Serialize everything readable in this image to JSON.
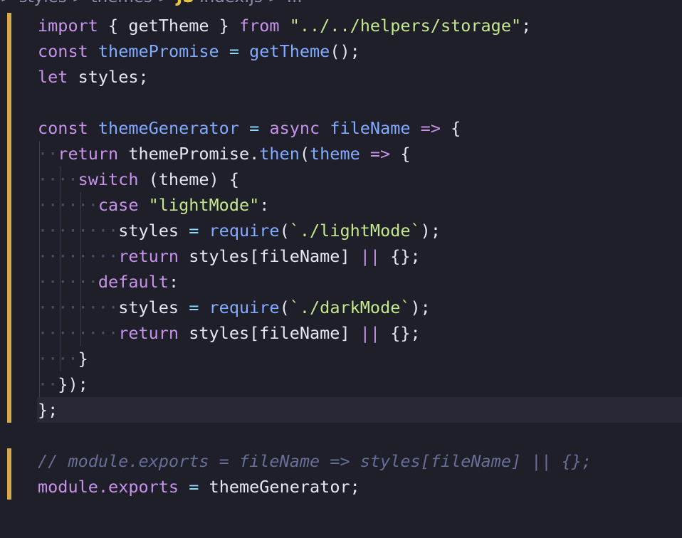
{
  "breadcrumb": {
    "text_before": "> styles > themes > ",
    "js_badge": "JS",
    "text_after": " index.js > ..."
  },
  "code": {
    "l1": {
      "kw": "import",
      "t1": " { getTheme } ",
      "kw2": "from",
      "sp": " ",
      "str": "\"../../helpers/storage\"",
      "end": ";"
    },
    "l2": {
      "kw": "const",
      "sp": " ",
      "var": "themePromise",
      "op": " = ",
      "fn": "getTheme",
      "end": "();"
    },
    "l3": {
      "kw": "let",
      "rest": " styles;"
    },
    "l5": {
      "kw": "const",
      "sp": " ",
      "var": "themeGenerator",
      "op": " = ",
      "kw2": "async",
      "sp2": " ",
      "param": "fileName",
      "arrow": " => ",
      "end": "{"
    },
    "l6": {
      "ind": "··",
      "kw": "return",
      "t1": " themePromise.",
      "fn": "then",
      "t2": "(",
      "param": "theme",
      "arrow": " => ",
      "end": "{"
    },
    "l7": {
      "ind": "····",
      "kw": "switch",
      "rest": " (theme) {"
    },
    "l8": {
      "ind": "······",
      "kw": "case",
      "sp": " ",
      "str": "\"lightMode\"",
      "end": ":"
    },
    "l9": {
      "ind": "········",
      "t1": "styles",
      "op": " = ",
      "fn": "require",
      "t2": "(",
      "str": "`./lightMode`",
      "end": ");"
    },
    "l10": {
      "ind": "········",
      "kw": "return",
      "t1": " styles[fileName] ",
      "op": "||",
      "end": " {};"
    },
    "l11": {
      "ind": "······",
      "kw": "default",
      "end": ":"
    },
    "l12": {
      "ind": "········",
      "t1": "styles",
      "op": " = ",
      "fn": "require",
      "t2": "(",
      "str": "`./darkMode`",
      "end": ");"
    },
    "l13": {
      "ind": "········",
      "kw": "return",
      "t1": " styles[fileName] ",
      "op": "||",
      "end": " {};"
    },
    "l14": {
      "ind": "····",
      "end": "}"
    },
    "l15": {
      "ind": "··",
      "end": "});"
    },
    "l16": {
      "end": "};"
    },
    "l18": {
      "comment": "// module.exports = fileName => styles[fileName] || {};"
    },
    "l19": {
      "t1": "module.",
      "prop": "exports",
      "op": " = ",
      "t2": "themeGenerator;"
    }
  }
}
